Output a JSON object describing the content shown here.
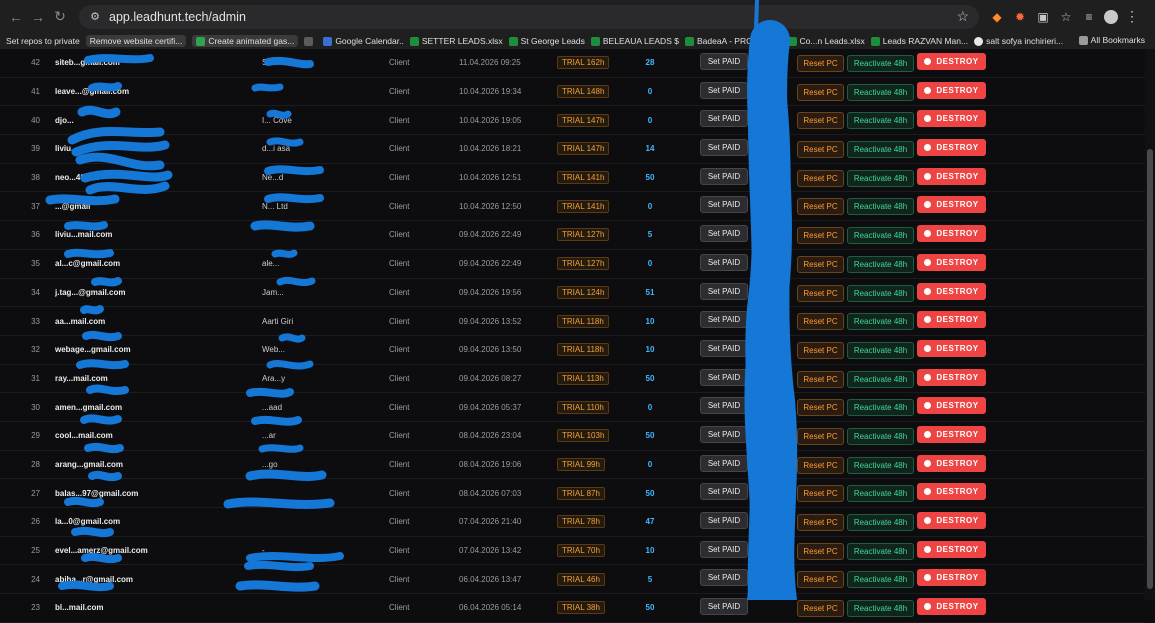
{
  "browser": {
    "url": "app.leadhunt.tech/admin",
    "bookmarks": [
      {
        "label": "Set repos to private",
        "chip": false,
        "icon": ""
      },
      {
        "label": "Remove website certifi...",
        "chip": true,
        "icon": ""
      },
      {
        "label": "Create animated gas...",
        "chip": true,
        "icon": "green"
      },
      {
        "label": "Google Calendar..",
        "chip": false,
        "icon": "blue"
      },
      {
        "label": "SETTER LEADS.xlsx",
        "chip": false,
        "icon": "sheet"
      },
      {
        "label": "St George Leads",
        "chip": false,
        "icon": "sheet"
      },
      {
        "label": "BELEAUA LEADS $",
        "chip": false,
        "icon": "sheet"
      },
      {
        "label": "BadeaA - PRO - Lea...",
        "chip": false,
        "icon": "sheet"
      },
      {
        "label": "Co...n Leads.xlsx",
        "chip": false,
        "icon": "sheet"
      },
      {
        "label": "Leads RAZVAN Man...",
        "chip": false,
        "icon": "sheet"
      },
      {
        "label": "salt sofya inchirieri...",
        "chip": false,
        "icon": "google"
      }
    ],
    "all_bookmarks_label": "All Bookmarks"
  },
  "buttons": {
    "set_paid": "Set PAID",
    "reset_pc": "Reset PC",
    "reactivate": "Reactivate 48h",
    "destroy": "DESTROY"
  },
  "rows": [
    {
      "id": "42",
      "email": "siteb...gmail.com",
      "name": "Sit...",
      "role": "Client",
      "date": "11.04.2026 09:25",
      "trial": "TRIAL 162h",
      "count": "28"
    },
    {
      "id": "41",
      "email": "leave...@gmail.com",
      "name": "",
      "role": "Client",
      "date": "10.04.2026 19:34",
      "trial": "TRIAL 148h",
      "count": "0"
    },
    {
      "id": "40",
      "email": "djo...",
      "name": "I... Cove",
      "role": "Client",
      "date": "10.04.2026 19:05",
      "trial": "TRIAL 147h",
      "count": "0"
    },
    {
      "id": "39",
      "email": "liviu...",
      "name": "d...i asa",
      "role": "Client",
      "date": "10.04.2026 18:21",
      "trial": "TRIAL 147h",
      "count": "14"
    },
    {
      "id": "38",
      "email": "neo...40@...",
      "name": "Ne...d",
      "role": "Client",
      "date": "10.04.2026 12:51",
      "trial": "TRIAL 141h",
      "count": "50"
    },
    {
      "id": "37",
      "email": "...@gmail",
      "name": "N... Ltd",
      "role": "Client",
      "date": "10.04.2026 12:50",
      "trial": "TRIAL 141h",
      "count": "0"
    },
    {
      "id": "36",
      "email": "liviu...mail.com",
      "name": "",
      "role": "Client",
      "date": "09.04.2026 22:49",
      "trial": "TRIAL 127h",
      "count": "5"
    },
    {
      "id": "35",
      "email": "al...c@gmail.com",
      "name": "ale...",
      "role": "Client",
      "date": "09.04.2026 22:49",
      "trial": "TRIAL 127h",
      "count": "0"
    },
    {
      "id": "34",
      "email": "j.tag...@gmail.com",
      "name": "Jam...",
      "role": "Client",
      "date": "09.04.2026 19:56",
      "trial": "TRIAL 124h",
      "count": "51"
    },
    {
      "id": "33",
      "email": "aa...mail.com",
      "name": "Aarti Giri",
      "role": "Client",
      "date": "09.04.2026 13:52",
      "trial": "TRIAL 118h",
      "count": "10"
    },
    {
      "id": "32",
      "email": "webage...gmail.com",
      "name": "Web...",
      "role": "Client",
      "date": "09.04.2026 13:50",
      "trial": "TRIAL 118h",
      "count": "10"
    },
    {
      "id": "31",
      "email": "ray...mail.com",
      "name": "Ara...y",
      "role": "Client",
      "date": "09.04.2026 08:27",
      "trial": "TRIAL 113h",
      "count": "50"
    },
    {
      "id": "30",
      "email": "amen...gmail.com",
      "name": "...aad",
      "role": "Client",
      "date": "09.04.2026 05:37",
      "trial": "TRIAL 110h",
      "count": "0"
    },
    {
      "id": "29",
      "email": "cool...mail.com",
      "name": "...ar",
      "role": "Client",
      "date": "08.04.2026 23:04",
      "trial": "TRIAL 103h",
      "count": "50"
    },
    {
      "id": "28",
      "email": "arang...gmail.com",
      "name": "...go",
      "role": "Client",
      "date": "08.04.2026 19:06",
      "trial": "TRIAL 99h",
      "count": "0"
    },
    {
      "id": "27",
      "email": "balas...97@gmail.com",
      "name": "",
      "role": "Client",
      "date": "08.04.2026 07:03",
      "trial": "TRIAL 87h",
      "count": "50"
    },
    {
      "id": "26",
      "email": "la...0@gmail.com",
      "name": "",
      "role": "Client",
      "date": "07.04.2026 21:40",
      "trial": "TRIAL 78h",
      "count": "47"
    },
    {
      "id": "25",
      "email": "evel...amerz@gmail.com",
      "name": "-",
      "role": "Client",
      "date": "07.04.2026 13:42",
      "trial": "TRIAL 70h",
      "count": "10"
    },
    {
      "id": "24",
      "email": "abiha...r@gmail.com",
      "name": "",
      "role": "Client",
      "date": "06.04.2026 13:47",
      "trial": "TRIAL 46h",
      "count": "5"
    },
    {
      "id": "23",
      "email": "bl...mail.com",
      "name": "",
      "role": "Client",
      "date": "06.04.2026 05:14",
      "trial": "TRIAL 38h",
      "count": "50"
    }
  ],
  "colors": {
    "destroy": "#ef4444",
    "reset_pc": "#ff9a2f",
    "reactivate": "#41d79b",
    "trial": "#f0a23b",
    "count": "#41b8ff",
    "redaction": "#1577d6"
  }
}
